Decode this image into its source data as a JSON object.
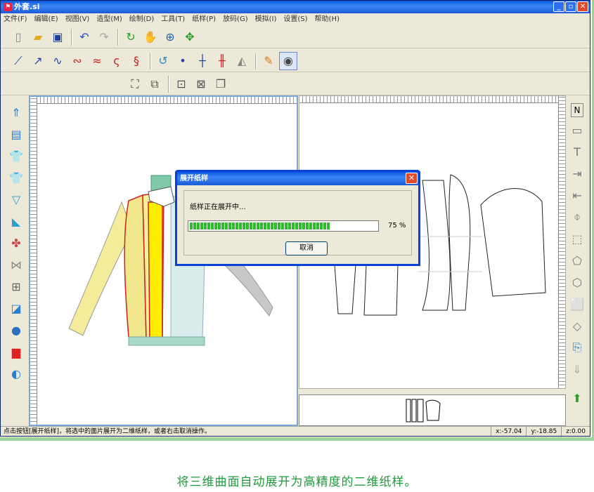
{
  "window": {
    "title": "外套.si",
    "controls": {
      "minimize": "_",
      "maximize": "▫",
      "close": "✕"
    }
  },
  "menu": [
    "文件(F)",
    "编辑(E)",
    "视图(V)",
    "造型(M)",
    "绘制(D)",
    "工具(T)",
    "纸样(P)",
    "放码(G)",
    "模拟(I)",
    "设置(S)",
    "帮助(H)"
  ],
  "dialog": {
    "title": "展开纸样",
    "close": "✕",
    "message": "纸样正在展开中...",
    "progress_fraction": 0.75,
    "progress_text": "75 %",
    "cancel_label": "取消"
  },
  "status": {
    "message": "点击按钮[展开纸样]，将选中的面片展开为二维纸样，或者右击取消操作。",
    "x": "x:-57.04",
    "y": "y:-18.85",
    "z": "z:0.00"
  },
  "caption": "将三维曲面自动展开为高精度的二维纸样。",
  "right_tools_label": "N"
}
